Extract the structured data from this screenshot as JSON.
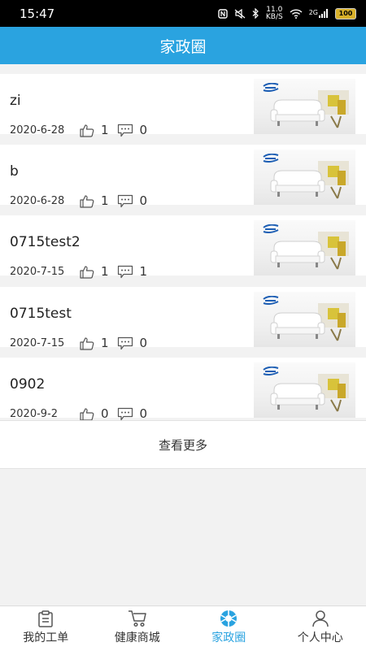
{
  "status_bar": {
    "time": "15:47",
    "net_speed_value": "11.0",
    "net_speed_unit": "KB/S",
    "network": "2G",
    "battery": "100"
  },
  "header": {
    "title": "家政圈"
  },
  "posts": [
    {
      "title": "zi",
      "date": "2020-6-28",
      "likes": "1",
      "comments": "0"
    },
    {
      "title": "b",
      "date": "2020-6-28",
      "likes": "1",
      "comments": "0"
    },
    {
      "title": "0715test2",
      "date": "2020-7-15",
      "likes": "1",
      "comments": "1"
    },
    {
      "title": "0715test",
      "date": "2020-7-15",
      "likes": "1",
      "comments": "0"
    },
    {
      "title": "0902",
      "date": "2020-9-2",
      "likes": "0",
      "comments": "0"
    }
  ],
  "load_more_label": "查看更多",
  "tabs": [
    {
      "label": "我的工单",
      "icon": "clipboard-icon"
    },
    {
      "label": "健康商城",
      "icon": "cart-icon"
    },
    {
      "label": "家政圈",
      "icon": "aperture-icon"
    },
    {
      "label": "个人中心",
      "icon": "user-icon"
    }
  ],
  "colors": {
    "accent": "#2aa3e0",
    "background": "#f2f2f2"
  }
}
